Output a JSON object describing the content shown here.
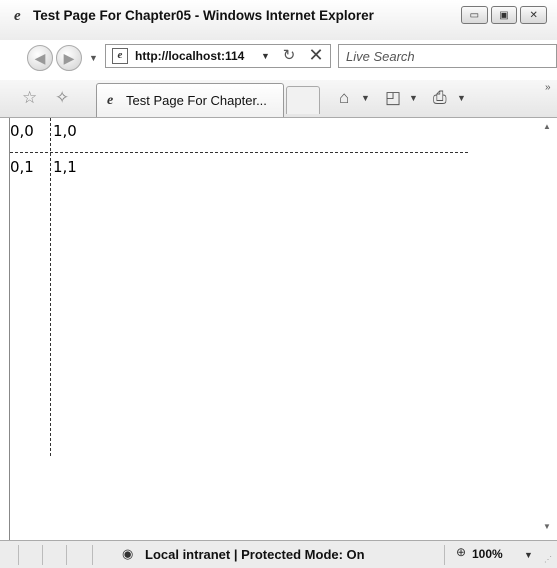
{
  "window": {
    "title": "Test Page For Chapter05 - Windows Internet Explorer",
    "buttons": {
      "minimize": "▭",
      "maximize": "▣",
      "close": "✕"
    }
  },
  "nav": {
    "back_glyph": "◀",
    "forward_glyph": "▶",
    "address": "http://localhost:114",
    "dropdown_glyph": "▼",
    "refresh_glyph": "↻",
    "stop_glyph": "✕",
    "search_placeholder": "Live Search"
  },
  "tabs": {
    "favorites_glyph": "☆",
    "add_favorite_glyph": "✧",
    "active_tab_label": "Test Page For Chapter...",
    "home_glyph": "⌂",
    "feeds_glyph": "◰",
    "print_glyph": "⎙",
    "overflow_glyph": "»"
  },
  "content": {
    "cells": [
      "0,0",
      "1,0",
      "0,1",
      "1,1"
    ]
  },
  "statusbar": {
    "network_glyph": "◉",
    "zone_text": "Local intranet | Protected Mode: On",
    "zoom_glyph": "⊕",
    "zoom_level": "100%"
  },
  "icons": {
    "ie_logo": "e",
    "page_icon": "e"
  }
}
